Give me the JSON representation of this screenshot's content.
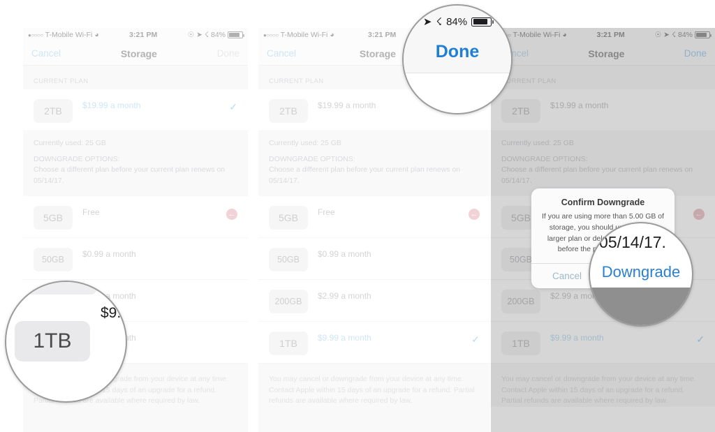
{
  "status_bar": {
    "signal_dots": "●○○○○",
    "carrier": "T-Mobile Wi-Fi",
    "wifi_icon": "wifi-icon",
    "time": "3:21 PM",
    "alarm_icon": "alarm-icon",
    "location_icon": "location-arrow-icon",
    "bluetooth_icon": "bluetooth-icon",
    "battery_percent": "84%",
    "battery_icon": "battery-icon"
  },
  "nav": {
    "cancel_label": "Cancel",
    "title": "Storage",
    "done_label": "Done"
  },
  "section": {
    "current_plan_header": "CURRENT PLAN"
  },
  "plans": {
    "current": {
      "size": "2TB",
      "price": "$19.99 a month",
      "selected": true
    },
    "options": [
      {
        "size": "5GB",
        "price": "Free",
        "selected": false,
        "remove_icon": "downgrade-arrow-icon"
      },
      {
        "size": "50GB",
        "price": "$0.99 a month",
        "selected": false
      },
      {
        "size": "200GB",
        "price": "$2.99 a month",
        "selected": false
      },
      {
        "size": "1TB",
        "price": "$9.99 a month",
        "selected": false
      }
    ],
    "options_panel2": [
      {
        "size": "5GB",
        "price": "Free",
        "selected": false,
        "remove_icon": "downgrade-arrow-icon"
      },
      {
        "size": "50GB",
        "price": "$0.99 a month",
        "selected": false
      },
      {
        "size": "200GB",
        "price": "$2.99 a month",
        "selected": false
      },
      {
        "size": "1TB",
        "price": "$9.99 a month",
        "selected": true
      }
    ]
  },
  "usage": {
    "currently_used": "Currently used: 25 GB",
    "downgrade_header": "DOWNGRADE OPTIONS:",
    "downgrade_text": "Choose a different plan before your current plan renews on 05/14/17."
  },
  "footnote": {
    "text": "You may cancel or downgrade from your device at any time. Contact Apple within 15 days of an upgrade for a refund. Partial refunds are available where required by law."
  },
  "dialog": {
    "title": "Confirm Downgrade",
    "message": "If you are using more than 5.00 GB of storage, you should upgrade to a larger plan or delete some content before the plan takes effect.",
    "cancel_label": "Cancel",
    "confirm_label": "Downgrade"
  },
  "loupe1": {
    "badge": "1TB",
    "price_fragment": "$9.."
  },
  "loupe2": {
    "location_icon": "location-arrow-icon",
    "bluetooth_icon": "bluetooth-icon",
    "battery_percent": "84%",
    "done_label": "Done"
  },
  "loupe3": {
    "date_fragment": "05/14/17.",
    "confirm_label": "Downgrade"
  },
  "colors": {
    "accent_blue": "#5aa9e6",
    "done_blue": "#1f7fd4",
    "remove_red": "#d4737f",
    "page_bg": "#f2f2f4"
  }
}
